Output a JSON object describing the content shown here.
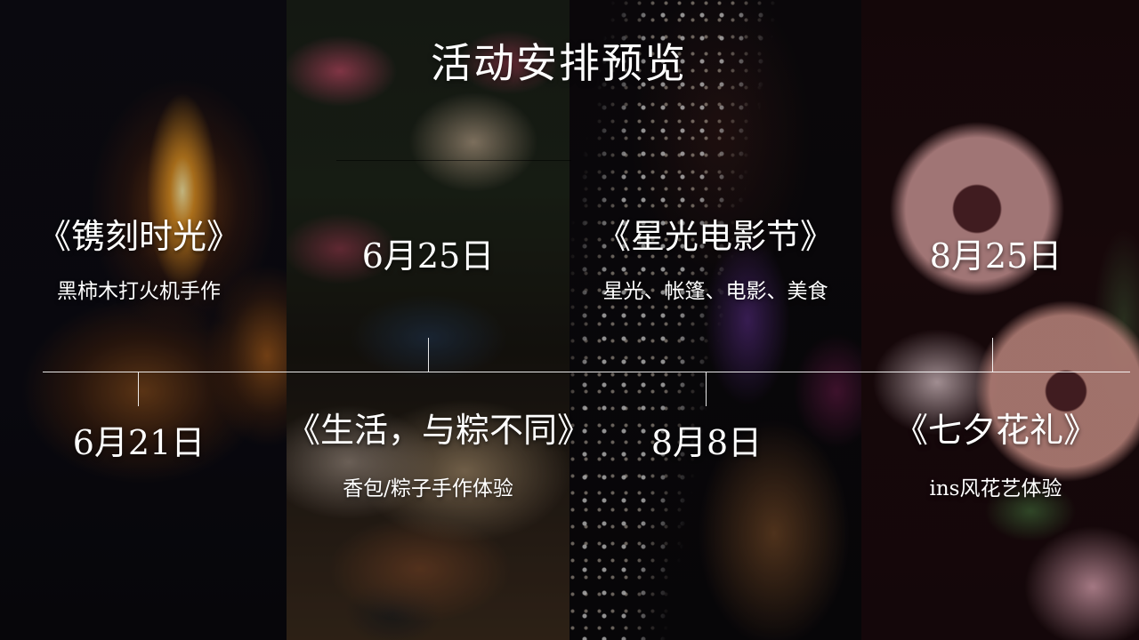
{
  "slide": {
    "title": "活动安排预览"
  },
  "events": [
    {
      "name": "《镌刻时光》",
      "desc": "黑柿木打火机手作",
      "date": "6月21日"
    },
    {
      "name": "《生活，与粽不同》",
      "desc": "香包/粽子手作体验",
      "date": "6月25日"
    },
    {
      "name": "《星光电影节》",
      "desc": "星光、帐篷、电影、美食",
      "date": "8月8日"
    },
    {
      "name": "《七夕花礼》",
      "desc": "ins风花艺体验",
      "date": "8月25日"
    }
  ],
  "colors": {
    "text": "#ffffff",
    "timeline": "#ffffff",
    "background": "#0b0a10"
  }
}
